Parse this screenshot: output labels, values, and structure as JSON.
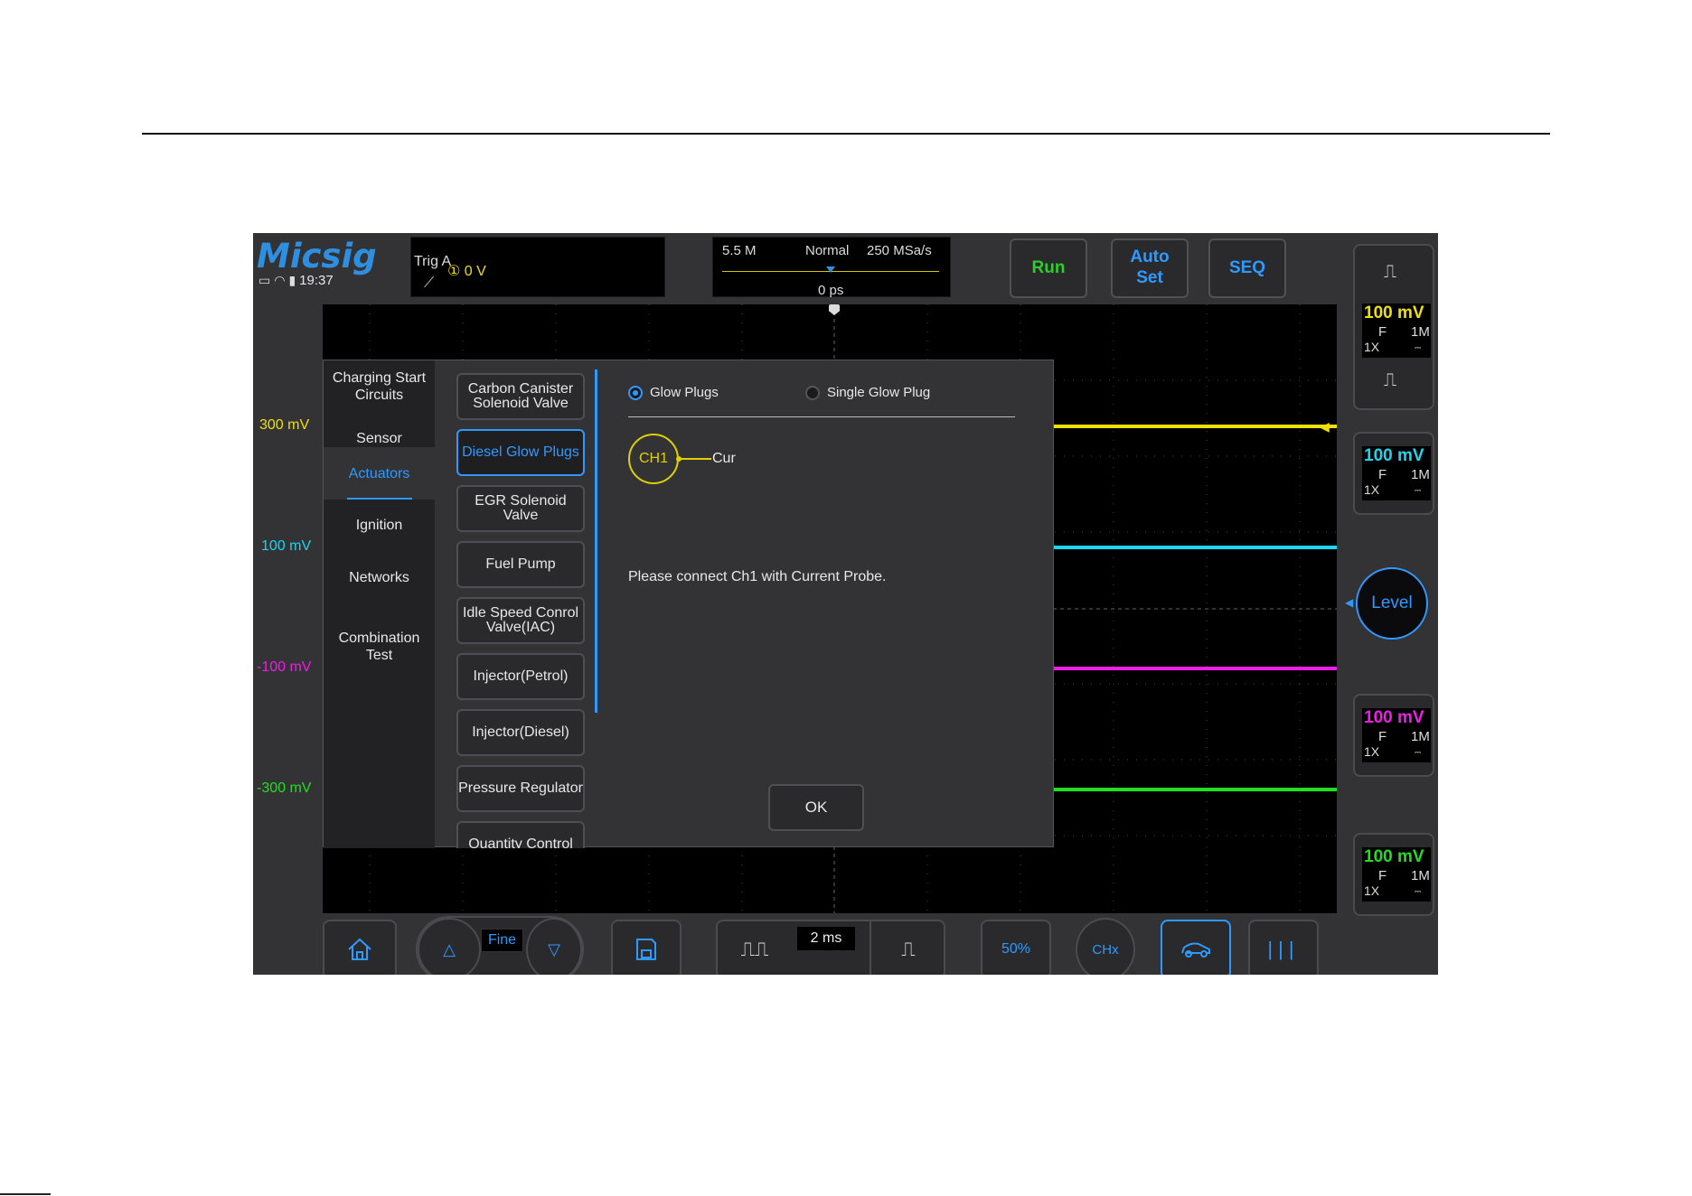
{
  "header": {
    "logo": "Micsig",
    "time": "19:37",
    "status_icons": [
      "monitor-icon",
      "wifi-icon",
      "battery-icon"
    ]
  },
  "trigger": {
    "label": "Trig",
    "source": "A",
    "level": "① 0  V",
    "edge_icon": "rising-edge-icon"
  },
  "timebase": {
    "memory": "5.5 M",
    "mode": "Normal",
    "sample_rate": "250 MSa/s",
    "position": "0 ps"
  },
  "buttons": {
    "run": "Run",
    "auto_set_line1": "Auto",
    "auto_set_line2": "Set",
    "seq": "SEQ"
  },
  "levels": [
    {
      "text": "300 mV",
      "color": "#f0e000"
    },
    {
      "text": "100 mV",
      "color": "#1ad6f0"
    },
    {
      "text": "-100 mV",
      "color": "#ee1ee8"
    },
    {
      "text": "-300 mV",
      "color": "#22dd22"
    }
  ],
  "channels": [
    {
      "volt": "100 mV",
      "coupling": "F",
      "impedance": "1M",
      "probe": "1X",
      "dc": "⎓",
      "color": "#f0e000"
    },
    {
      "volt": "100 mV",
      "coupling": "F",
      "impedance": "1M",
      "probe": "1X",
      "dc": "⎓",
      "color": "#1ad6f0"
    },
    {
      "volt": "100 mV",
      "coupling": "F",
      "impedance": "1M",
      "probe": "1X",
      "dc": "⎓",
      "color": "#ee1ee8"
    },
    {
      "volt": "100 mV",
      "coupling": "F",
      "impedance": "1M",
      "probe": "1X",
      "dc": "⎓",
      "color": "#22dd22"
    }
  ],
  "level_knob": "Level",
  "dialog": {
    "categories": [
      "Charging Start Circuits",
      "Sensor",
      "Actuators",
      "Ignition",
      "Networks",
      "Combination Test"
    ],
    "active_category": "Actuators",
    "items": [
      "Carbon Canister Solenoid Valve",
      "Diesel Glow Plugs",
      "EGR Solenoid Valve",
      "Fuel Pump",
      "Idle Speed Conrol Valve(IAC)",
      "Injector(Petrol)",
      "Injector(Diesel)",
      "Pressure Regulator",
      "Quantity Control"
    ],
    "active_item": "Diesel Glow Plugs",
    "options": [
      {
        "label": "Glow Plugs",
        "selected": true
      },
      {
        "label": "Single Glow Plug",
        "selected": false
      }
    ],
    "channel": "CH1",
    "probe_label": "Cur",
    "message": "Please connect Ch1 with Current Probe.",
    "ok": "OK"
  },
  "toolbar": {
    "fine": "Fine",
    "time_div": "2 ms",
    "pct": "50%",
    "chx": "CHx"
  },
  "colors": {
    "accent": "#2e9aff",
    "run": "#28d028",
    "ch1": "#f0e000",
    "ch2": "#1ad6f0",
    "ch3": "#ee1ee8",
    "ch4": "#22dd22"
  }
}
